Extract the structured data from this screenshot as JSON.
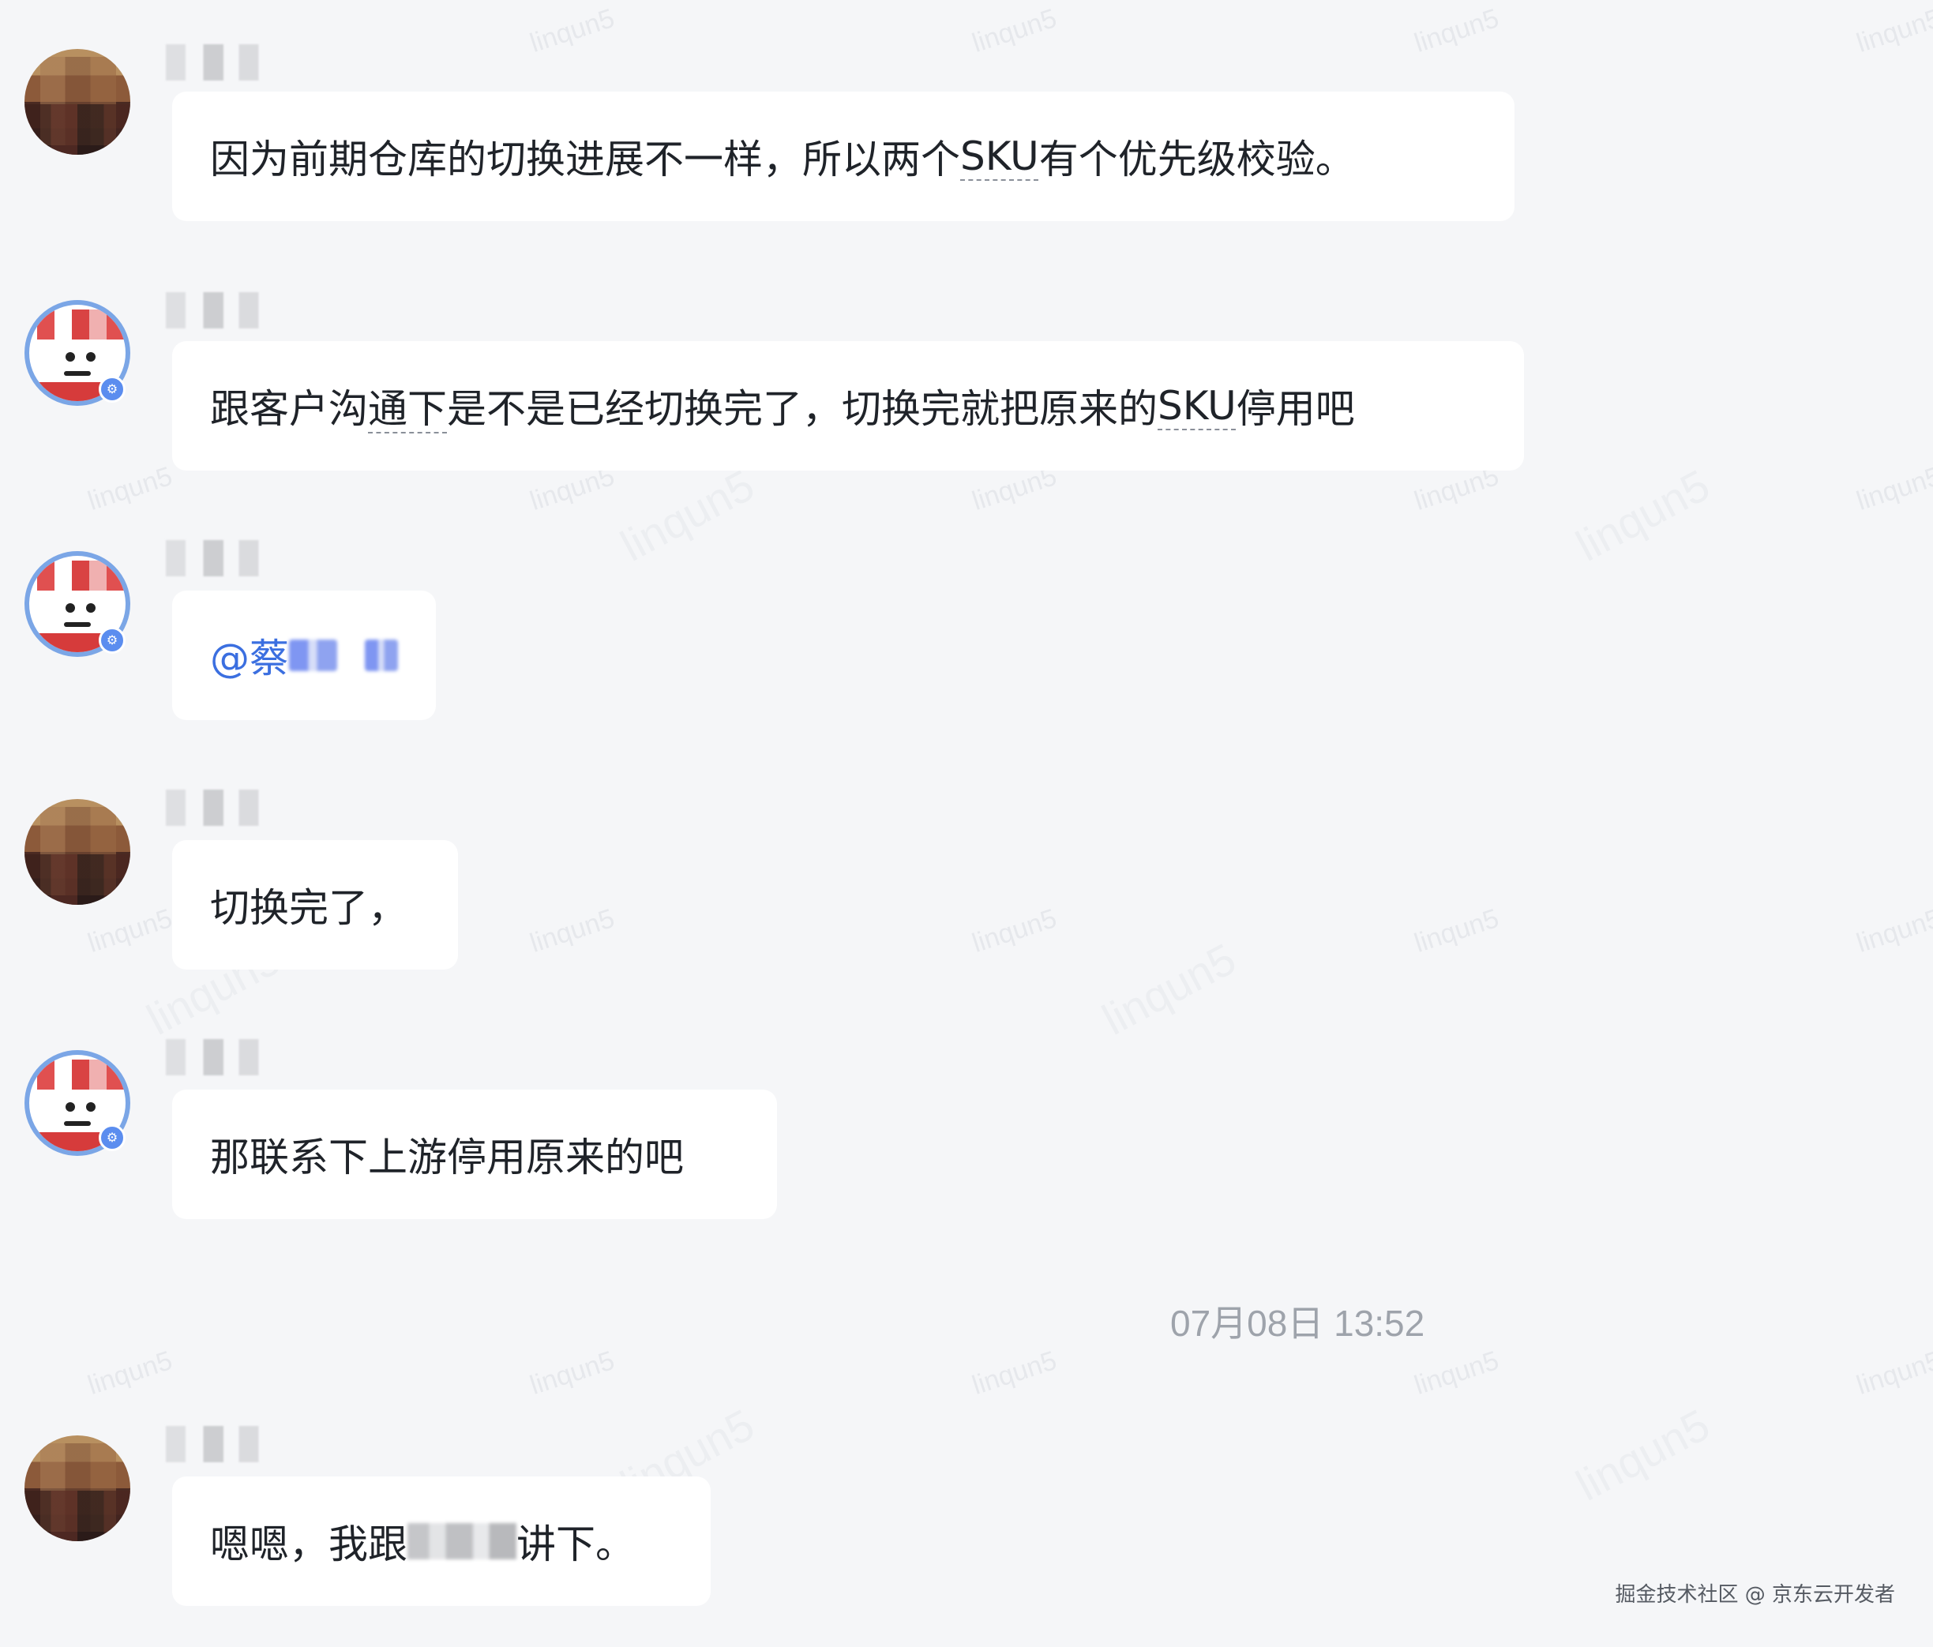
{
  "watermark": {
    "text": "linqun5"
  },
  "messages": [
    {
      "avatar": "brown-avatar",
      "text_parts": [
        "因为前期仓库的切换进展不一样，所以两个",
        "SKU",
        "有个优先级校验。"
      ]
    },
    {
      "avatar": "joy-avatar",
      "text_parts": [
        "跟客户沟",
        "通下",
        "是不是已经切换完了，切换完就把原来的",
        "SKU",
        "停用吧"
      ]
    },
    {
      "avatar": "joy-avatar",
      "mention_prefix": "@蔡"
    },
    {
      "avatar": "brown-avatar",
      "text": "切换完了，"
    },
    {
      "avatar": "joy-avatar",
      "text": "那联系下上游停用原来的吧"
    },
    {
      "avatar": "brown-avatar",
      "text_before": "嗯嗯，我跟",
      "text_after": "讲下。"
    }
  ],
  "timestamp": "07月08日 13:52",
  "footer": "掘金技术社区 @ 京东云开发者"
}
